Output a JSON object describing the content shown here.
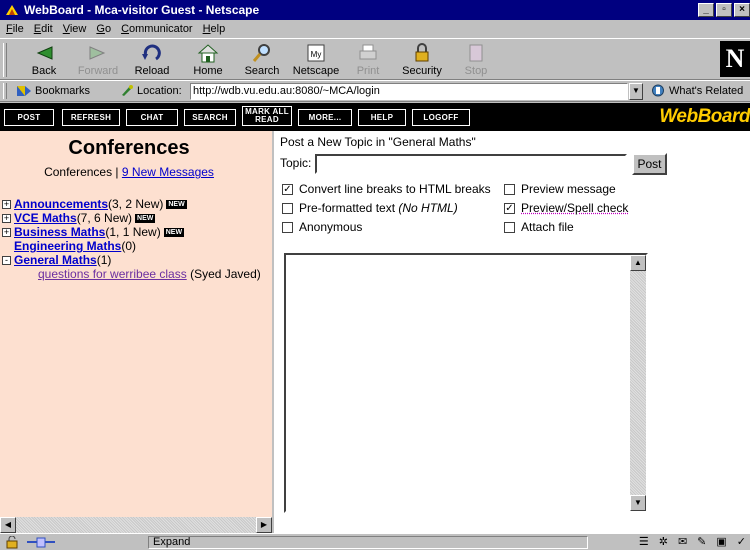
{
  "window": {
    "title": "WebBoard - Mca-visitor Guest - Netscape"
  },
  "menubar": [
    "File",
    "Edit",
    "View",
    "Go",
    "Communicator",
    "Help"
  ],
  "toolbar": {
    "buttons": [
      {
        "label": "Back",
        "icon": "back-arrow-icon",
        "enabled": true
      },
      {
        "label": "Forward",
        "icon": "forward-arrow-icon",
        "enabled": false
      },
      {
        "label": "Reload",
        "icon": "reload-icon",
        "enabled": true
      },
      {
        "label": "Home",
        "icon": "home-icon",
        "enabled": true
      },
      {
        "label": "Search",
        "icon": "search-icon",
        "enabled": true
      },
      {
        "label": "Netscape",
        "icon": "netscape-icon",
        "enabled": true
      },
      {
        "label": "Print",
        "icon": "print-icon",
        "enabled": false
      },
      {
        "label": "Security",
        "icon": "lock-icon",
        "enabled": true
      },
      {
        "label": "Stop",
        "icon": "stop-icon",
        "enabled": false
      }
    ],
    "logo": "N"
  },
  "location": {
    "bookmarks_label": "Bookmarks",
    "location_label": "Location:",
    "url": "http://wdb.vu.edu.au:8080/~MCA/login",
    "related_label": "What's Related"
  },
  "webboard": {
    "nav": [
      "POST",
      "REFRESH",
      "CHAT",
      "SEARCH",
      "MARK ALL READ",
      "MORE...",
      "HELP",
      "LOGOFF"
    ],
    "logo": "WebBoard",
    "left": {
      "title": "Conferences",
      "subtitle_prefix": "Conferences | ",
      "new_messages_link": "9 New Messages",
      "tree": [
        {
          "expander": "+",
          "name": "Announcements",
          "count": " (3, 2 New)",
          "new": true
        },
        {
          "expander": "+",
          "name": "VCE Maths",
          "count": " (7, 6 New)",
          "new": true
        },
        {
          "expander": "+",
          "name": "Business Maths",
          "count": " (1, 1 New)",
          "new": true
        },
        {
          "expander": "",
          "name": "Engineering Maths",
          "count": " (0)",
          "new": false
        },
        {
          "expander": "-",
          "name": "General Maths",
          "count": " (1)",
          "new": false
        }
      ],
      "thread": {
        "title": "questions for werribee class ",
        "author": "(Syed Javed)"
      },
      "new_badge": "NEW"
    },
    "right": {
      "heading": "Post a New Topic in \"General Maths\"",
      "topic_label": "Topic:",
      "topic_value": "",
      "post_button": "Post",
      "options": {
        "convert_breaks": {
          "label": "Convert line breaks to HTML breaks",
          "checked": true
        },
        "preview_message": {
          "label": "Preview message",
          "checked": false
        },
        "preformatted": {
          "label": "Pre-formatted text ",
          "label_em": "(No HTML)",
          "checked": false
        },
        "preview_spell": {
          "label": "Preview/Spell check",
          "checked": true
        },
        "anonymous": {
          "label": "Anonymous",
          "checked": false
        },
        "attach_file": {
          "label": "Attach file",
          "checked": false
        }
      },
      "message_body": ""
    }
  },
  "statusbar": {
    "text": "Expand"
  },
  "colors": {
    "titlebar": "#000080",
    "left_bg": "#fde0d0",
    "webboard_logo": "#ffcc00",
    "link": "#0000cc"
  }
}
